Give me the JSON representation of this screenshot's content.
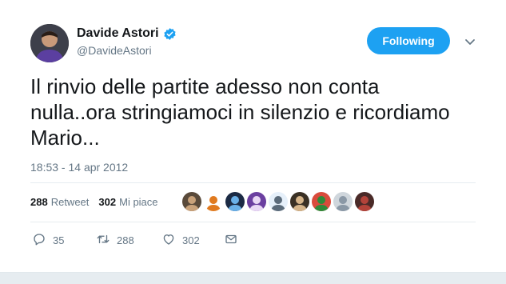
{
  "author": {
    "display_name": "Davide Astori",
    "handle": "@DavideAstori",
    "verified": true
  },
  "follow_button": {
    "label": "Following",
    "color": "#1da1f2"
  },
  "tweet": {
    "lines": [
      "Il rinvio delle partite adesso non conta",
      "nulla..ora stringiamoci in silenzio e ricordiamo",
      "Mario..."
    ],
    "timestamp": "18:53 - 14 apr 2012"
  },
  "stats": {
    "retweets": {
      "count": "288",
      "label": "Retweet"
    },
    "likes": {
      "count": "302",
      "label": "Mi piace"
    }
  },
  "likers": [
    {
      "icon": "user-avatar",
      "bg": "#5a4a3a",
      "fg": "#c9a27a"
    },
    {
      "icon": "user-avatar",
      "bg": "#ffffff",
      "fg": "#e07a1f"
    },
    {
      "icon": "user-avatar",
      "bg": "#1b2a44",
      "fg": "#6ab0e8"
    },
    {
      "icon": "user-avatar",
      "bg": "#6b3fa0",
      "fg": "#e9d8f5"
    },
    {
      "icon": "user-avatar",
      "bg": "#e6f0fa",
      "fg": "#5b6b7a"
    },
    {
      "icon": "user-avatar",
      "bg": "#3a3024",
      "fg": "#d6b58a"
    },
    {
      "icon": "user-avatar",
      "bg": "#d94b3c",
      "fg": "#2e8b3a"
    },
    {
      "icon": "user-avatar",
      "bg": "#cfd6dc",
      "fg": "#8a98a6"
    },
    {
      "icon": "user-avatar",
      "bg": "#4a2a28",
      "fg": "#b3433a"
    }
  ],
  "actions": {
    "reply": {
      "icon": "reply-icon",
      "count": "35"
    },
    "retweet": {
      "icon": "retweet-icon",
      "count": "288"
    },
    "like": {
      "icon": "heart-icon",
      "count": "302"
    },
    "dm": {
      "icon": "envelope-icon"
    }
  }
}
